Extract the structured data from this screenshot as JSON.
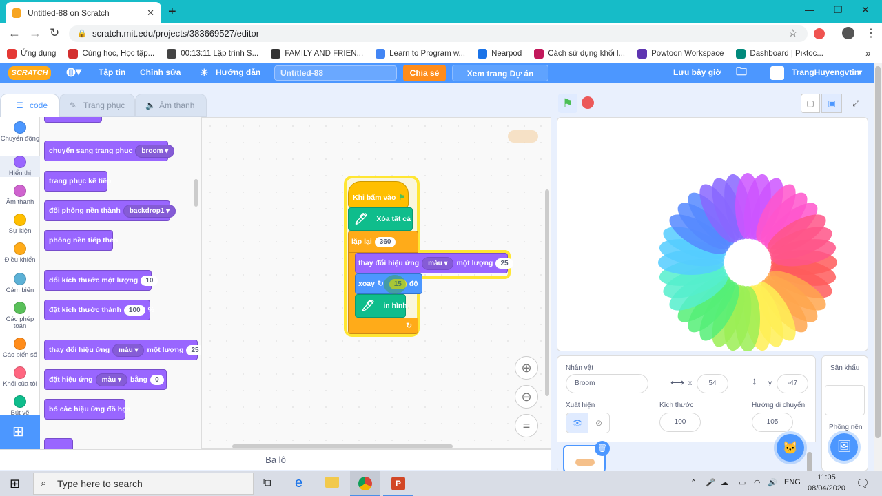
{
  "browser": {
    "tab_title": "Untitled-88 on Scratch",
    "url": "scratch.mit.edu/projects/383669527/editor",
    "bookmarks": [
      {
        "label": "Ứng dụng",
        "color": "#e53935"
      },
      {
        "label": "Cùng học, Học tập...",
        "color": "#d32f2f"
      },
      {
        "label": "00:13:11 Lập trình S...",
        "color": "#444444"
      },
      {
        "label": "FAMILY AND FRIEN...",
        "color": "#333333"
      },
      {
        "label": "Learn to Program w...",
        "color": "#4285f4"
      },
      {
        "label": "Nearpod",
        "color": "#1a73e8"
      },
      {
        "label": "Cách sử dụng khối l...",
        "color": "#c2185b"
      },
      {
        "label": "Powtoon Workspace",
        "color": "#5e35b1"
      },
      {
        "label": "Dashboard | Piktoc...",
        "color": "#00897b"
      }
    ]
  },
  "menu": {
    "logo": "SCRATCH",
    "file": "Tập tin",
    "edit": "Chỉnh sửa",
    "tutorials": "Hướng dẫn",
    "project_title": "Untitled-88",
    "share": "Chia sẻ",
    "see_project": "Xem trang Dự án",
    "save_now": "Lưu bây giờ",
    "username": "TrangHuyengvtin"
  },
  "tabs": {
    "code": "code",
    "costumes": "Trang phục",
    "sounds": "Âm thanh"
  },
  "categories": [
    {
      "label": "Chuyển động",
      "color": "#4c97ff"
    },
    {
      "label": "Hiển thị",
      "color": "#9966ff"
    },
    {
      "label": "Âm thanh",
      "color": "#cf63cf"
    },
    {
      "label": "Sự kiện",
      "color": "#ffbf00"
    },
    {
      "label": "Điều khiển",
      "color": "#ffab19"
    },
    {
      "label": "Cảm biến",
      "color": "#5cb1d6"
    },
    {
      "label": "Các phép toán",
      "color": "#59c059"
    },
    {
      "label": "Các biến số",
      "color": "#ff8c1a"
    },
    {
      "label": "Khối của tôi",
      "color": "#ff6680"
    },
    {
      "label": "Bút vẽ",
      "color": "#0fbd8c"
    }
  ],
  "palette": {
    "switch_costume": "chuyển sang trang phục",
    "switch_costume_val": "broom",
    "next_costume": "trang phục kế tiếp",
    "switch_backdrop": "đổi phông nền thành",
    "switch_backdrop_val": "backdrop1",
    "next_backdrop": "phông nền tiếp theo",
    "change_size": "đổi kích thước một lượng",
    "change_size_val": "10",
    "set_size": "đặt kích thước thành",
    "set_size_val": "100",
    "set_size_unit": "%",
    "change_effect": "thay đổi hiệu ứng",
    "change_effect_drop": "màu",
    "change_effect_by": "một lượng",
    "change_effect_val": "25",
    "set_effect": "đặt hiệu ứng",
    "set_effect_drop": "màu",
    "set_effect_to": "bằng",
    "set_effect_val": "0",
    "clear_effects": "bỏ các hiệu ứng đồ họa"
  },
  "script": {
    "when_flag": "Khi bấm vào",
    "erase_all": "Xóa tất cả",
    "repeat": "lặp lại",
    "repeat_val": "360",
    "change_effect": "thay đổi hiệu ứng",
    "change_effect_drop": "màu",
    "change_effect_by": "một lượng",
    "change_effect_val": "25",
    "turn": "xoay",
    "turn_val": "15",
    "degrees": "độ",
    "stamp": "in hình",
    "repeat_arrow": "↻"
  },
  "backpack": "Ba lô",
  "sprite_info": {
    "sprite_label": "Nhân vật",
    "sprite_name": "Broom",
    "x_label": "x",
    "x_value": "54",
    "y_label": "y",
    "y_value": "-47",
    "show_label": "Xuất hiện",
    "size_label": "Kích thước",
    "size_value": "100",
    "direction_label": "Hướng di chuyển",
    "direction_value": "105"
  },
  "stage_panel": {
    "label": "Sân khấu",
    "backdrops_label": "Phông nền"
  },
  "taskbar": {
    "search_placeholder": "Type here to search",
    "lang": "ENG",
    "time": "11:05",
    "date": "08/04/2020"
  },
  "flower_colors": [
    "#ff5c5c",
    "#ffa64d",
    "#ffee55",
    "#9bee55",
    "#55ee77",
    "#55eecc",
    "#55ccff",
    "#5588ff",
    "#8866ff",
    "#cc55ff",
    "#ff55cc",
    "#ff5588"
  ]
}
